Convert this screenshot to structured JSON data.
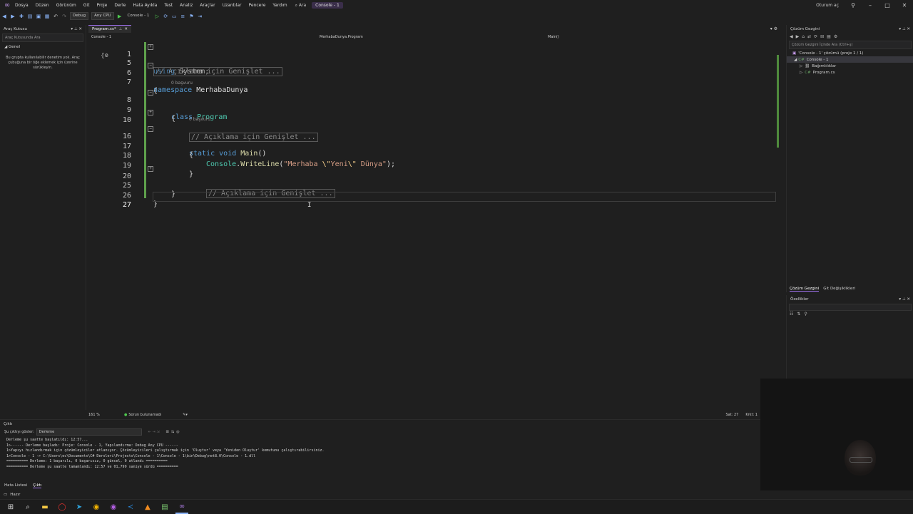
{
  "menubar": {
    "items": [
      "Dosya",
      "Düzen",
      "Görünüm",
      "Git",
      "Proje",
      "Derle",
      "Hata Ayıkla",
      "Test",
      "Analiz",
      "Araçlar",
      "Uzantılar",
      "Pencere",
      "Yardım"
    ],
    "search_label": "Ara",
    "solution_badge": "Console - 1",
    "signin": "Oturum aç"
  },
  "toolbar": {
    "config": "Debug",
    "platform": "Any CPU",
    "run_target": "Console - 1"
  },
  "toolbox": {
    "title": "Araç Kutusu",
    "search_placeholder": "Araç Kutusunda Ara",
    "group": "Genel",
    "empty_message": "Bu grupta kullanılabilir denetim yok. Araç çubuğuna bir öğe eklemek için üzerine sürükleyin."
  },
  "editor": {
    "tab_label": "Program.cs*",
    "project_dropdown": "Console - 1",
    "class_dropdown": "MerhabaDunya.Program",
    "member_dropdown": "Main()",
    "lines": {
      "l1": {
        "num": "1",
        "collapsed": "// Açıklama için Genişlet ..."
      },
      "l5": {
        "num": "5",
        "kw": "using",
        "rest": " System;"
      },
      "l6": {
        "num": "6",
        "kw": "namespace",
        "rest": " MerhabaDunya"
      },
      "l7": {
        "num": "7",
        "text": "{"
      },
      "l8": {
        "num": "8",
        "refs": "0 başvuru",
        "kw": "class",
        "type": "Program"
      },
      "l9": {
        "num": "9",
        "text": "{"
      },
      "l10": {
        "num": "10",
        "collapsed": "// Açıklama için Genişlet ..."
      },
      "l16": {
        "num": "16",
        "refs": "0 başvuru",
        "kw1": "static",
        "kw2": "void",
        "method": "Main",
        "rest": "()"
      },
      "l17": {
        "num": "17",
        "text": "{"
      },
      "l18": {
        "num": "18",
        "type": "Console",
        "method": "WriteLine",
        "str1": "\"Merhaba ",
        "esc1": "\\\"",
        "str2": "Yeni",
        "esc2": "\\\"",
        "str3": " Dünya\"",
        "tail": ");"
      },
      "l19": {
        "num": "19",
        "text": "}"
      },
      "l20": {
        "num": "20",
        "collapsed": "// Açıklama için Genişlet ..."
      },
      "l25": {
        "num": "25",
        "text": "}"
      },
      "l26": {
        "num": "26",
        "text": "}"
      },
      "l27": {
        "num": "27",
        "text": ""
      }
    },
    "zoom": "161 %",
    "issues": "Sorun bulunamadı",
    "line_info": "Sat: 27",
    "char_info": "Krkt: 1"
  },
  "solution_explorer": {
    "title": "Çözüm Gezgini",
    "search_placeholder": "Çözüm Gezgini İçinde Ara (Ctrl+ş)",
    "solution_node": "'Console - 1' çözümü (proje 1 / 1)",
    "project_node": "Console - 1",
    "dependencies": "Bağımlılıklar",
    "file": "Program.cs",
    "tabs": [
      "Çözüm Gezgini",
      "Git Değişiklikleri"
    ]
  },
  "properties": {
    "title": "Özellikler"
  },
  "output": {
    "title": "Çıktı",
    "show_from_label": "Şu çıktıyı göster:",
    "source": "Derleme",
    "lines": [
      "Derleme şu saatte başlatıldı: 12:57...",
      "1>------ Derleme başladı: Proje: Console - 1, Yapılandırma: Debug Any CPU ------",
      "1>Yapıyı hızlandırmak için çözümleyiciler atlanıyor. Çözümleyicileri çalıştırmak için 'Oluştur' veya 'Yeniden Oluştur' komutunu çalıştırabilirsiniz.",
      "1>Console - 1 -> C:\\Users\\ec\\Documents\\C# Dersleri\\Projects\\Console - 1\\Console - 1\\bin\\Debug\\net8.0\\Console - 1.dll",
      "========== Derleme: 1 başarılı, 0 başarısız, 0 güncel, 0 atlandı ==========",
      "========== Derleme şu saatte tamamlandı: 12:57 ve 01,799 saniye sürdü =========="
    ]
  },
  "bottom_tabs": [
    "Hata Listesi",
    "Çıktı"
  ],
  "status": "Hazır"
}
